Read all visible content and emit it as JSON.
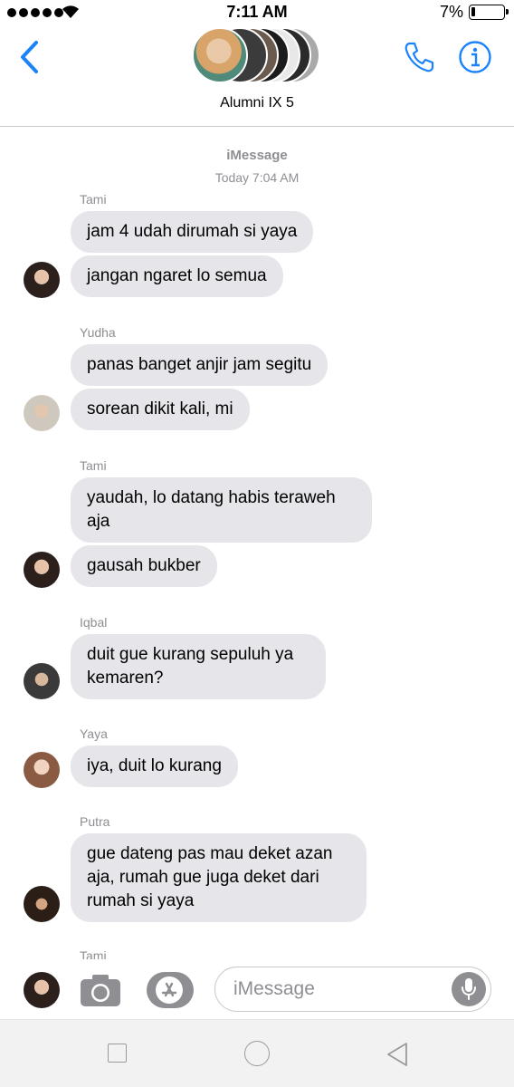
{
  "status_bar": {
    "time": "7:11 AM",
    "battery_percent": "7%",
    "battery_level": 0.07
  },
  "header": {
    "group_name": "Alumni IX 5",
    "accent_color": "#1a82fb"
  },
  "chat": {
    "service_label": "iMessage",
    "timestamp": "Today 7:04 AM",
    "groups": [
      {
        "sender": "Tami",
        "messages": [
          "jam 4 udah dirumah si yaya",
          "jangan ngaret lo semua"
        ]
      },
      {
        "sender": "Yudha",
        "messages": [
          "panas banget anjir jam segitu",
          "sorean dikit kali, mi"
        ]
      },
      {
        "sender": "Tami",
        "messages": [
          "yaudah, lo datang habis teraweh aja",
          "gausah bukber"
        ]
      },
      {
        "sender": "Iqbal",
        "messages": [
          "duit gue kurang sepuluh ya kemaren?"
        ]
      },
      {
        "sender": "Yaya",
        "messages": [
          "iya, duit lo kurang"
        ]
      },
      {
        "sender": "Putra",
        "messages": [
          "gue dateng pas mau deket azan aja, rumah gue juga deket dari rumah si yaya"
        ]
      },
      {
        "sender": "Tami",
        "messages": []
      }
    ]
  },
  "input": {
    "placeholder": "iMessage",
    "value": ""
  },
  "colors": {
    "bubble": "#e5e5ea",
    "meta_text": "#8e8e93"
  }
}
